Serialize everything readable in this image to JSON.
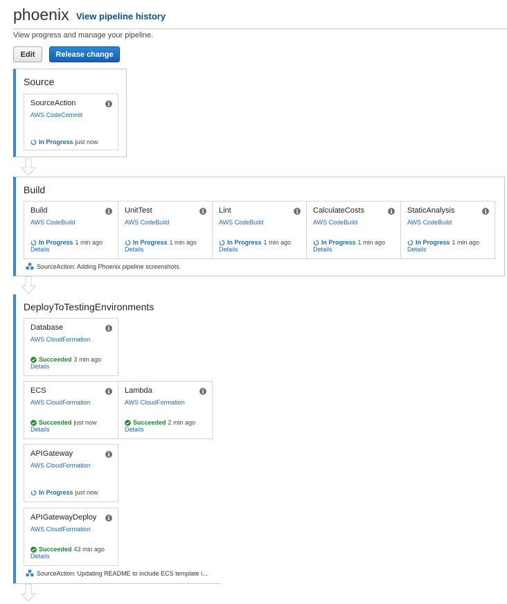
{
  "header": {
    "title": "phoenix",
    "history_link": "View pipeline history"
  },
  "subtitle": "View progress and manage your pipeline.",
  "toolbar": {
    "edit_label": "Edit",
    "release_label": "Release change"
  },
  "stages": {
    "source": {
      "name": "Source",
      "actions": [
        {
          "name": "SourceAction",
          "provider": "AWS CodeCommit",
          "status": "In Progress",
          "time": "just now"
        }
      ]
    },
    "build": {
      "name": "Build",
      "actions": [
        {
          "name": "Build",
          "provider": "AWS CodeBuild",
          "status": "In Progress",
          "time": "1 min ago",
          "details": "Details"
        },
        {
          "name": "UnitTest",
          "provider": "AWS CodeBuild",
          "status": "In Progress",
          "time": "1 min ago",
          "details": "Details"
        },
        {
          "name": "Lint",
          "provider": "AWS CodeBuild",
          "status": "In Progress",
          "time": "1 min ago",
          "details": "Details"
        },
        {
          "name": "CalculateCosts",
          "provider": "AWS CodeBuild",
          "status": "In Progress",
          "time": "1 min ago",
          "details": "Details"
        },
        {
          "name": "StaticAnalysis",
          "provider": "AWS CodeBuild",
          "status": "In Progress",
          "time": "1 min ago",
          "details": "Details"
        }
      ],
      "commit": "SourceAction: Adding Phoenix pipeline screenshots."
    },
    "deploy": {
      "name": "DeployToTestingEnvironments",
      "actions": [
        {
          "name": "Database",
          "provider": "AWS CloudFormation",
          "status": "Succeeded",
          "time": "3 min ago",
          "details": "Details"
        },
        {
          "name": "ECS",
          "provider": "AWS CloudFormation",
          "status": "Succeeded",
          "time": "just now",
          "details": "Details"
        },
        {
          "name": "Lambda",
          "provider": "AWS CloudFormation",
          "status": "Succeeded",
          "time": "2 min ago",
          "details": "Details"
        },
        {
          "name": "APIGateway",
          "provider": "AWS CloudFormation",
          "status": "In Progress",
          "time": "just now"
        },
        {
          "name": "APIGatewayDeploy",
          "provider": "AWS CloudFormation",
          "status": "Succeeded",
          "time": "43 min ago",
          "details": "Details"
        }
      ],
      "commit": "SourceAction: Updating README to include ECS template i..."
    }
  },
  "icons": {
    "info": "info-icon",
    "in_progress": "refresh-icon",
    "succeeded": "check-circle-icon",
    "commit": "commit-icon",
    "arrow": "down-arrow-icon"
  },
  "colors": {
    "accent": "#3a87d6",
    "link": "#1d68b8",
    "success": "#1b8a2e",
    "primary_button": "#1361b6"
  }
}
